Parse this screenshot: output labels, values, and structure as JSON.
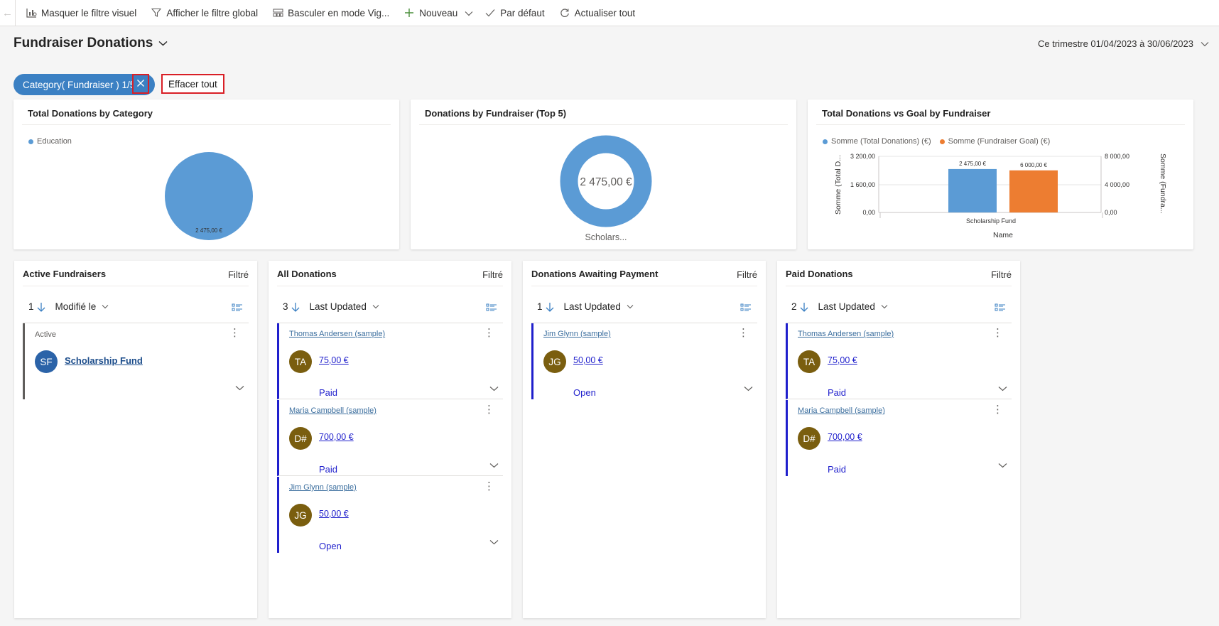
{
  "commandbar": {
    "items": [
      {
        "label": "Masquer le filtre visuel",
        "icon": "visual-filter-icon"
      },
      {
        "label": "Afficher le filtre global",
        "icon": "filter-icon"
      },
      {
        "label": "Basculer en mode Vig...",
        "icon": "tile-mode-icon"
      },
      {
        "label": "Nouveau",
        "icon": "plus-icon"
      },
      {
        "label": "Par défaut",
        "icon": "checkmark-icon"
      },
      {
        "label": "Actualiser tout",
        "icon": "refresh-icon"
      }
    ]
  },
  "header": {
    "title": "Fundraiser Donations",
    "period": "Ce trimestre 01/04/2023 à 30/06/2023"
  },
  "filters": {
    "chip_label": "Category( Fundraiser ) 1/5",
    "clear_all": "Effacer tout"
  },
  "colors": {
    "accent": "#3b80c3",
    "series1": "#5b9bd5",
    "series2": "#ed7d31",
    "record_bar": "#1f1fcc",
    "avatar_brown": "#7a5e0f",
    "avatar_blue": "#2b63a8",
    "highlight": "#d91f26"
  },
  "charts": {
    "category": {
      "title": "Total Donations by Category",
      "legend": "Education",
      "slice_label": "2 475,00 €"
    },
    "top5": {
      "title": "Donations by Fundraiser (Top 5)",
      "center": "2 475,00 €",
      "label": "Scholars..."
    },
    "goal": {
      "title": "Total Donations vs Goal by Fundraiser",
      "legend1": "Somme (Total Donations) (€)",
      "legend2": "Somme (Fundraiser Goal) (€)",
      "left_ticks": [
        "3 200,00",
        "1 600,00",
        "0,00"
      ],
      "right_ticks": [
        "8 000,00",
        "4 000,00",
        "0,00"
      ],
      "left_axis": "Somme (Total D...",
      "right_axis": "Somme (Fundra...",
      "category": "Scholarship Fund",
      "xlabel": "Name",
      "bar1_label": "2 475,00 €",
      "bar2_label": "6 000,00 €"
    }
  },
  "chart_data": [
    {
      "type": "pie",
      "title": "Total Donations by Category",
      "categories": [
        "Education"
      ],
      "values": [
        2475
      ],
      "unit": "€"
    },
    {
      "type": "pie",
      "title": "Donations by Fundraiser (Top 5)",
      "categories": [
        "Scholars..."
      ],
      "values": [
        2475
      ],
      "unit": "€"
    },
    {
      "type": "bar",
      "title": "Total Donations vs Goal by Fundraiser",
      "categories": [
        "Scholarship Fund"
      ],
      "series": [
        {
          "name": "Somme (Total Donations) (€)",
          "values": [
            2475
          ],
          "axis": "left"
        },
        {
          "name": "Somme (Fundraiser Goal) (€)",
          "values": [
            6000
          ],
          "axis": "right"
        }
      ],
      "xlabel": "Name",
      "ylabel": "Somme (Total D...",
      "y2label": "Somme (Fundra...",
      "ylim": [
        0,
        3200
      ],
      "y2lim": [
        0,
        8000
      ],
      "legend": "top-left"
    }
  ],
  "panels": {
    "filtered_label": "Filtré",
    "active": {
      "title": "Active Fundraisers",
      "count": "1",
      "sort": "Modifié le",
      "rows": [
        {
          "status_label": "Active",
          "initials": "SF",
          "name": "Scholarship Fund"
        }
      ]
    },
    "all": {
      "title": "All Donations",
      "count": "3",
      "sort": "Last Updated",
      "rows": [
        {
          "contact": "Thomas Andersen (sample)",
          "initials": "TA",
          "amount": "75,00 €",
          "status": "Paid"
        },
        {
          "contact": "Maria Campbell (sample)",
          "initials": "D#",
          "amount": "700,00 €",
          "status": "Paid"
        },
        {
          "contact": "Jim Glynn (sample)",
          "initials": "JG",
          "amount": "50,00 €",
          "status": "Open"
        }
      ]
    },
    "awaiting": {
      "title": "Donations Awaiting Payment",
      "count": "1",
      "sort": "Last Updated",
      "rows": [
        {
          "contact": "Jim Glynn (sample)",
          "initials": "JG",
          "amount": "50,00 €",
          "status": "Open"
        }
      ]
    },
    "paid": {
      "title": "Paid Donations",
      "count": "2",
      "sort": "Last Updated",
      "rows": [
        {
          "contact": "Thomas Andersen (sample)",
          "initials": "TA",
          "amount": "75,00 €",
          "status": "Paid"
        },
        {
          "contact": "Maria Campbell (sample)",
          "initials": "D#",
          "amount": "700,00 €",
          "status": "Paid"
        }
      ]
    }
  }
}
